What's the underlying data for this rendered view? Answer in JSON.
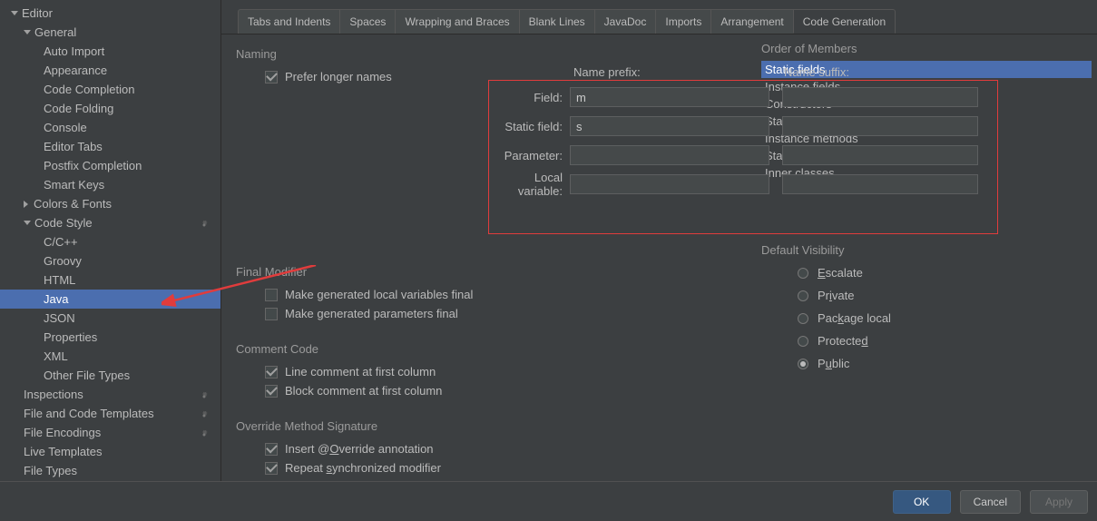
{
  "sidebar": {
    "editor_label": "Editor",
    "general_label": "General",
    "general": [
      "Auto Import",
      "Appearance",
      "Code Completion",
      "Code Folding",
      "Console",
      "Editor Tabs",
      "Postfix Completion",
      "Smart Keys"
    ],
    "colors_fonts": "Colors & Fonts",
    "code_style_label": "Code Style",
    "code_style": [
      "C/C++",
      "Groovy",
      "HTML",
      "Java",
      "JSON",
      "Properties",
      "XML",
      "Other File Types"
    ],
    "code_style_selected": "Java",
    "inspections": "Inspections",
    "file_code_templates": "File and Code Templates",
    "file_encodings": "File Encodings",
    "live_templates": "Live Templates",
    "file_types": "File Types"
  },
  "tabs": {
    "items": [
      "Tabs and Indents",
      "Spaces",
      "Wrapping and Braces",
      "Blank Lines",
      "JavaDoc",
      "Imports",
      "Arrangement",
      "Code Generation"
    ],
    "active": "Code Generation"
  },
  "naming": {
    "section": "Naming",
    "prefer_longer": "Prefer longer names",
    "prefix_header": "Name prefix:",
    "suffix_header": "Name suffix:",
    "rows": [
      {
        "label": "Field:",
        "prefix": "m",
        "suffix": ""
      },
      {
        "label": "Static field:",
        "prefix": "s",
        "suffix": ""
      },
      {
        "label": "Parameter:",
        "prefix": "",
        "suffix": ""
      },
      {
        "label": "Local variable:",
        "prefix": "",
        "suffix": ""
      }
    ]
  },
  "final_modifier": {
    "section": "Final Modifier",
    "local_vars": "Make generated local variables final",
    "params": "Make generated parameters final"
  },
  "comment_code": {
    "section": "Comment Code",
    "line": "Line comment at first column",
    "block": "Block comment at first column"
  },
  "override": {
    "section": "Override Method Signature",
    "insert_html": "Insert @<u>O</u>verride annotation",
    "repeat_html": "Repeat <u>s</u>ynchronized modifier"
  },
  "order": {
    "section": "Order of Members",
    "items": [
      "Static fields",
      "Instance fields",
      "Constructors",
      "Static methods",
      "Instance methods",
      "Static inner classes",
      "Inner classes"
    ],
    "selected": "Static fields"
  },
  "visibility": {
    "section": "Default Visibility",
    "options": [
      {
        "html": "<u>E</u>scalate"
      },
      {
        "html": "Pr<u>i</u>vate"
      },
      {
        "html": "Pac<u>k</u>age local"
      },
      {
        "html": "Protecte<u>d</u>"
      },
      {
        "html": "P<u>u</u>blic"
      }
    ],
    "selected_index": 4
  },
  "footer": {
    "ok": "OK",
    "cancel": "Cancel",
    "apply": "Apply"
  }
}
